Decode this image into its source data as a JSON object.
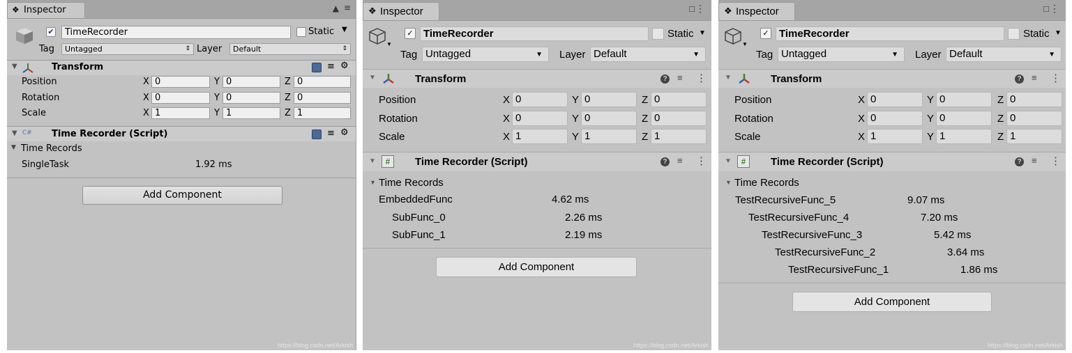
{
  "watermark": "https://blog.csdn.net/Arkish",
  "panels": [
    {
      "tab_title": "Inspector",
      "object_name": "TimeRecorder",
      "static_label": "Static",
      "tag_label": "Tag",
      "tag_value": "Untagged",
      "layer_label": "Layer",
      "layer_value": "Default",
      "transform_title": "Transform",
      "rows": [
        {
          "label": "Position",
          "x": "0",
          "y": "0",
          "z": "0"
        },
        {
          "label": "Rotation",
          "x": "0",
          "y": "0",
          "z": "0"
        },
        {
          "label": "Scale",
          "x": "1",
          "y": "1",
          "z": "1"
        }
      ],
      "axis": {
        "x": "X",
        "y": "Y",
        "z": "Z"
      },
      "script_title": "Time Recorder (Script)",
      "records_header": "Time Records",
      "records": [
        {
          "name": "SingleTask",
          "time": "1.92 ms"
        }
      ],
      "add_component": "Add Component"
    },
    {
      "tab_title": "Inspector",
      "object_name": "TimeRecorder",
      "static_label": "Static",
      "tag_label": "Tag",
      "tag_value": "Untagged",
      "layer_label": "Layer",
      "layer_value": "Default",
      "transform_title": "Transform",
      "rows": [
        {
          "label": "Position",
          "x": "0",
          "y": "0",
          "z": "0"
        },
        {
          "label": "Rotation",
          "x": "0",
          "y": "0",
          "z": "0"
        },
        {
          "label": "Scale",
          "x": "1",
          "y": "1",
          "z": "1"
        }
      ],
      "axis": {
        "x": "X",
        "y": "Y",
        "z": "Z"
      },
      "script_title": "Time Recorder (Script)",
      "records_header": "Time Records",
      "records": [
        {
          "name": "EmbeddedFunc",
          "time": "4.62 ms"
        },
        {
          "name": "SubFunc_0",
          "time": "2.26 ms"
        },
        {
          "name": "SubFunc_1",
          "time": "2.19 ms"
        }
      ],
      "add_component": "Add Component"
    },
    {
      "tab_title": "Inspector",
      "object_name": "TimeRecorder",
      "static_label": "Static",
      "tag_label": "Tag",
      "tag_value": "Untagged",
      "layer_label": "Layer",
      "layer_value": "Default",
      "transform_title": "Transform",
      "rows": [
        {
          "label": "Position",
          "x": "0",
          "y": "0",
          "z": "0"
        },
        {
          "label": "Rotation",
          "x": "0",
          "y": "0",
          "z": "0"
        },
        {
          "label": "Scale",
          "x": "1",
          "y": "1",
          "z": "1"
        }
      ],
      "axis": {
        "x": "X",
        "y": "Y",
        "z": "Z"
      },
      "script_title": "Time Recorder (Script)",
      "records_header": "Time Records",
      "records": [
        {
          "name": "TestRecursiveFunc_5",
          "time": "9.07 ms"
        },
        {
          "name": "TestRecursiveFunc_4",
          "time": "7.20 ms"
        },
        {
          "name": "TestRecursiveFunc_3",
          "time": "5.42 ms"
        },
        {
          "name": "TestRecursiveFunc_2",
          "time": "3.64 ms"
        },
        {
          "name": "TestRecursiveFunc_1",
          "time": "1.86 ms"
        }
      ],
      "add_component": "Add Component"
    }
  ]
}
